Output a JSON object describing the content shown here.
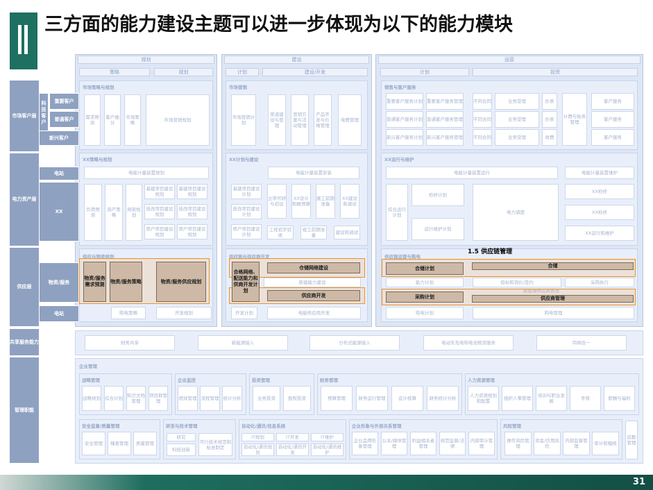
{
  "title": "三方面的能力建设主题可以进一步体现为以下的能力模块",
  "page_number": "31",
  "colors": {
    "brand": "#1e7060",
    "highlight": "#e8922e",
    "module": "#cdb9a6"
  },
  "columns": {
    "plan": "规划",
    "build": "建设",
    "ops": "运营"
  },
  "column_sub": {
    "a": "策略",
    "b": "规划",
    "c": "计划",
    "d": "建设/开发",
    "e": "计划",
    "f": "投资"
  },
  "row_labels": {
    "market": "市场客户层",
    "power": "电力资产层",
    "supply": "供应层",
    "shared": "共享服务能力",
    "mgmt": "管理职能"
  },
  "market_sub": {
    "tech": "科技客户",
    "big": "重要客户",
    "mid": "普通客户",
    "new": "新兴客户"
  },
  "power_sub": {
    "elec": "电站",
    "xx": "XX"
  },
  "supply_sub": {
    "mat": "物资/服务",
    "elec": "电站"
  },
  "plan_groups": {
    "market": "市场策略与规划",
    "power": "XX策略与规划",
    "supply": "供应与物资规划"
  },
  "plan_boxes": {
    "m1": "需求预测",
    "m2": "客户细分",
    "m3": "市场策略",
    "m4": "市场营销规划",
    "p_top": "电能计量装置规划",
    "p1": "负荷预测",
    "p2": "资产策略",
    "p3": "网架规划",
    "p4": "基建项目建设规划",
    "p5": "基建项目建设规划",
    "p6": "技改项目建设规划",
    "p7": "技改项目建设规划",
    "p8": "用户项目建设规划",
    "p9": "用户项目建设规划",
    "s_bottom1": "购电策略",
    "s_bottom2": "开发规划"
  },
  "build_groups": {
    "market": "市场营销",
    "power": "XX计划与建设",
    "supply": "供应链与供应商开发"
  },
  "build_boxes": {
    "m1": "市场营销计划",
    "m2": "渠道建设与管理",
    "m3": "营销方案与活动管理",
    "m4": "产品开发与价格管理",
    "m5": "电费管理",
    "p_top": "电能计量装置安装",
    "p1": "基建项目建设计划",
    "p2": "技改项目建设计划",
    "p3": "用户项目建设计划",
    "p4": "立项可研与初设",
    "p5": "XX设计和概预算",
    "p6": "施工前期准备",
    "p7": "XX建设和调试",
    "p8": "工程初步验收",
    "p9": "竣工前期准备",
    "p10": "建设和调试",
    "s_bottom1": "开发计划",
    "s_bottom2": "电能供应商开发",
    "s_mid": "新建能力建设"
  },
  "ops_groups": {
    "market": "销售与客户服务",
    "power": "XX运行与维护",
    "supply": "供应链运营与购电"
  },
  "ops_boxes": {
    "m1": "重要客户服务计划",
    "m2": "重要客户服务管理",
    "m3": "普通客户服务计划",
    "m4": "普通客户服务管理",
    "m5": "新兴客户服务计划",
    "m6": "新兴客户服务管理",
    "m7": "不同合同",
    "m8": "业务受理",
    "m9": "抄表",
    "m10": "不同合同",
    "m11": "业务受理",
    "m12": "抄表",
    "m13": "不同合同",
    "m14": "业务受理",
    "m15": "收费",
    "m16": "计费与账务管理",
    "m17": "客户服务",
    "m18": "客户服务",
    "m19": "客户服务",
    "p_top1": "电能计量装置运行",
    "p_top2": "电能计量装置维护",
    "p1": "综合运行计划",
    "p2": "检修计划",
    "p3": "运行维护计划",
    "p4": "电力调度",
    "p5": "XX检修",
    "p6": "XX检修",
    "p7": "XX运行和维护",
    "s1": "能力计划",
    "s2": "招标和询价/签约",
    "s3": "采购执行",
    "s4": "新能源供应商管理",
    "s_bottom1": "购电计划",
    "s_bottom2": "购电管理"
  },
  "highlight_modules": {
    "h1": "物资/服务需求预测",
    "h2": "物资/服务策略",
    "h3": "物资/服务供应规划",
    "h4": "合格网络、配送能力和供商开发计划",
    "h5": "仓储网络建设",
    "h6": "供应商开发",
    "h7": "合储计划",
    "h8": "采购计划",
    "h9": "合储",
    "h10": "供应商管理"
  },
  "annotation": "1.5 供应链管理",
  "shared_services": [
    "财务共享",
    "新能源接入",
    "分布式能源接入",
    "电动车充电和电池租赁服务",
    "四网合一"
  ],
  "mgmt": {
    "title": "企业管理",
    "strategy": {
      "title": "战略管理",
      "items": [
        "战略规划",
        "综合计划",
        "知识文档管理",
        "项目群管理"
      ]
    },
    "enterprise": {
      "title": "企业监控",
      "items": [
        "绩效管理",
        "流程管理",
        "统计分析"
      ]
    },
    "invest": {
      "title": "投资管理",
      "items": [
        "业务投资",
        "股权投资"
      ]
    },
    "finance": {
      "title": "财务管理",
      "items": [
        "预算管理",
        "财务运行管理",
        "会计核算",
        "财务统计分析"
      ]
    },
    "hr": {
      "title": "人力资源管理",
      "items": [
        "人力资源规划和配置",
        "组织人事管理",
        "培训与职业发展",
        "考核",
        "薪酬与福利"
      ]
    },
    "safety": {
      "title": "安全监督/质量管理",
      "items": [
        "安全管理",
        "稽查管理",
        "质量管理"
      ]
    },
    "rd": {
      "title": "研发与技术管理",
      "items": [
        "研究",
        "科技创新",
        "可行技术规范和标准制定"
      ]
    },
    "it": {
      "title": "自动化/通讯/信息系统",
      "items": [
        "IT规划",
        "IT开发",
        "IT维护",
        "自动化/通讯规划",
        "自动化/通讯开发",
        "自动化/通讯维护"
      ]
    },
    "corp": {
      "title": "企业形象与外部关系管理",
      "items": [
        "企业品牌形象管理",
        "公关/媒体管理",
        "利益相关者管理",
        "规范监督/法律",
        "内部审计管理"
      ]
    },
    "risk": {
      "title": "风险管理",
      "items": [
        "操作风险管理",
        "资金/信用风险",
        "内部监督管理",
        "审计和稽核"
      ]
    },
    "other": "后勤管理"
  }
}
